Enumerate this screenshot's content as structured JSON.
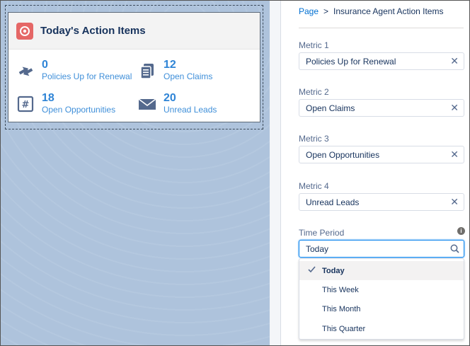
{
  "card": {
    "title": "Today's Action Items",
    "metrics": [
      {
        "value": "0",
        "label": "Policies Up for Renewal",
        "icon": "renewal-icon"
      },
      {
        "value": "12",
        "label": "Open Claims",
        "icon": "claims-icon"
      },
      {
        "value": "18",
        "label": "Open Opportunities",
        "icon": "opportunities-icon"
      },
      {
        "value": "20",
        "label": "Unread Leads",
        "icon": "email-icon"
      }
    ]
  },
  "breadcrumb": {
    "root": "Page",
    "current": "Insurance Agent Action Items"
  },
  "fields": [
    {
      "label": "Metric 1",
      "value": "Policies Up for Renewal"
    },
    {
      "label": "Metric 2",
      "value": "Open Claims"
    },
    {
      "label": "Metric 3",
      "value": "Open Opportunities"
    },
    {
      "label": "Metric 4",
      "value": "Unread Leads"
    }
  ],
  "time_period": {
    "label": "Time Period",
    "value": "Today",
    "options": [
      "Today",
      "This Week",
      "This Month",
      "This Quarter"
    ],
    "selected": "Today"
  },
  "colors": {
    "accent": "#0070d2",
    "metric_number": "#2e84d6",
    "card_icon": "#e56766"
  }
}
